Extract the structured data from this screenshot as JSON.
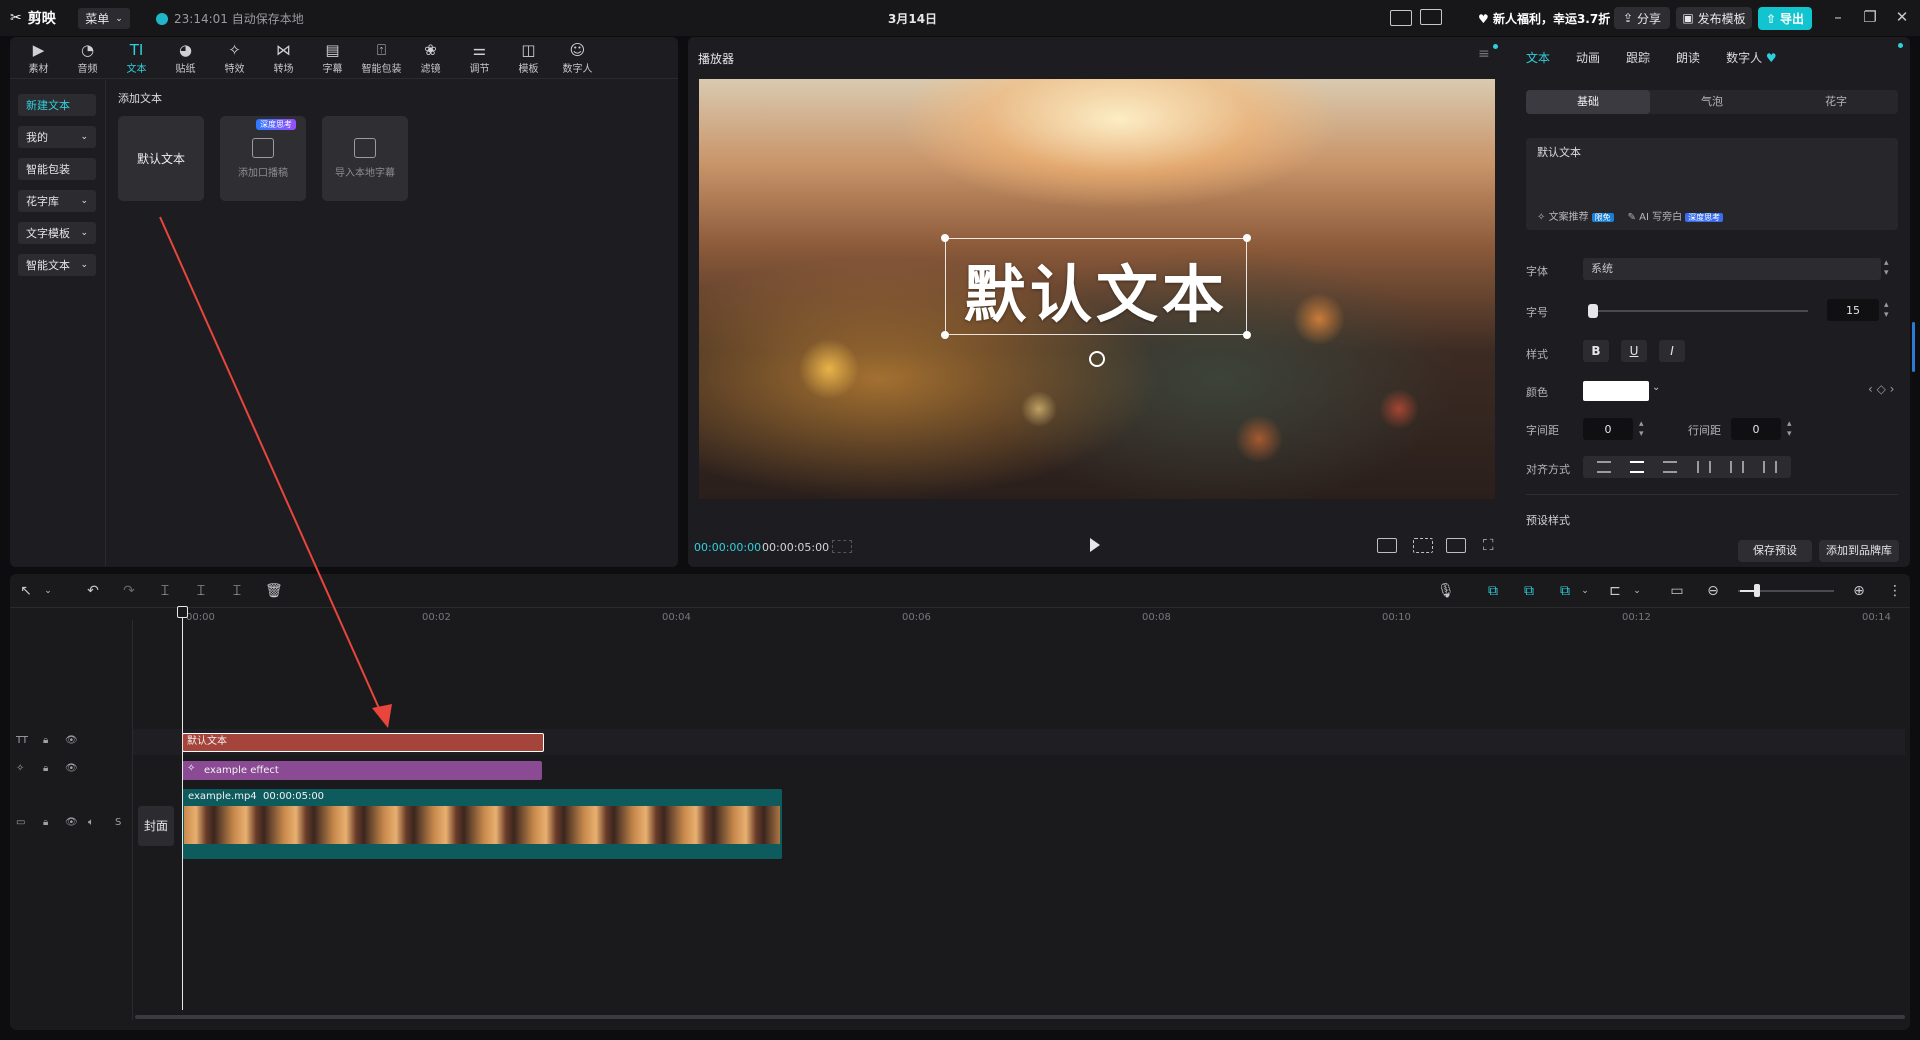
{
  "titlebar": {
    "app_name": "剪映",
    "menu_label": "菜单",
    "autosave": "23:14:01 自动保存本地",
    "date": "3月14日",
    "promo": "新人福利，幸运3.7折",
    "share": "分享",
    "publish_template": "发布模板",
    "export": "导出"
  },
  "tool_tabs": [
    {
      "label": "素材",
      "icon": "media-icon"
    },
    {
      "label": "音频",
      "icon": "audio-icon"
    },
    {
      "label": "文本",
      "icon": "text-icon",
      "active": true
    },
    {
      "label": "贴纸",
      "icon": "sticker-icon"
    },
    {
      "label": "特效",
      "icon": "effects-icon"
    },
    {
      "label": "转场",
      "icon": "transition-icon"
    },
    {
      "label": "字幕",
      "icon": "subtitle-icon"
    },
    {
      "label": "智能包装",
      "icon": "smart-pack-icon"
    },
    {
      "label": "滤镜",
      "icon": "filter-icon"
    },
    {
      "label": "调节",
      "icon": "adjust-icon"
    },
    {
      "label": "模板",
      "icon": "template-icon"
    },
    {
      "label": "数字人",
      "icon": "digital-human-icon"
    }
  ],
  "side_nav": [
    {
      "label": "新建文本",
      "active": true
    },
    {
      "label": "我的",
      "dropdown": true
    },
    {
      "label": "智能包装"
    },
    {
      "label": "花字库",
      "dropdown": true
    },
    {
      "label": "文字模板",
      "dropdown": true
    },
    {
      "label": "智能文本",
      "dropdown": true
    }
  ],
  "add_text": {
    "section_label": "添加文本",
    "cards": [
      {
        "label": "默认文本"
      },
      {
        "label": "添加口播稿",
        "badge": "深度思考"
      },
      {
        "label": "导入本地字幕"
      }
    ]
  },
  "player": {
    "title": "播放器",
    "overlay_text": "默认文本",
    "time_current": "00:00:00:00",
    "time_total": "00:00:05:00"
  },
  "inspector": {
    "tabs": [
      "文本",
      "动画",
      "跟踪",
      "朗读",
      "数字人"
    ],
    "segments": [
      "基础",
      "气泡",
      "花字"
    ],
    "text_value": "默认文本",
    "tool_copywriting": "文案推荐",
    "tool_copywriting_badge": "限免",
    "tool_ai_write": "AI 写旁白",
    "tool_ai_badge": "深度思考",
    "font_label": "字体",
    "font_value": "系统",
    "size_label": "字号",
    "size_value": "15",
    "style_label": "样式",
    "color_label": "颜色",
    "color_value": "#ffffff",
    "char_spacing_label": "字间距",
    "char_spacing_value": "0",
    "line_spacing_label": "行间距",
    "line_spacing_value": "0",
    "align_label": "对齐方式",
    "preset_label": "预设样式",
    "save_preset": "保存预设",
    "add_brand": "添加到品牌库"
  },
  "timeline": {
    "ticks": [
      "00:00",
      "00:02",
      "00:04",
      "00:06",
      "00:08",
      "00:10",
      "00:12",
      "00:14"
    ],
    "text_clip": "默认文本",
    "effect_clip": "example effect",
    "video_clip_name": "example.mp4",
    "video_clip_duration": "00:00:05:00",
    "cover_label": "封面"
  },
  "colors": {
    "accent": "#11c4d0",
    "text_clip": "#a5443a",
    "effect_clip": "#8a4a94",
    "video_clip": "#0e5b5e",
    "annotation_arrow": "#e8453c"
  }
}
